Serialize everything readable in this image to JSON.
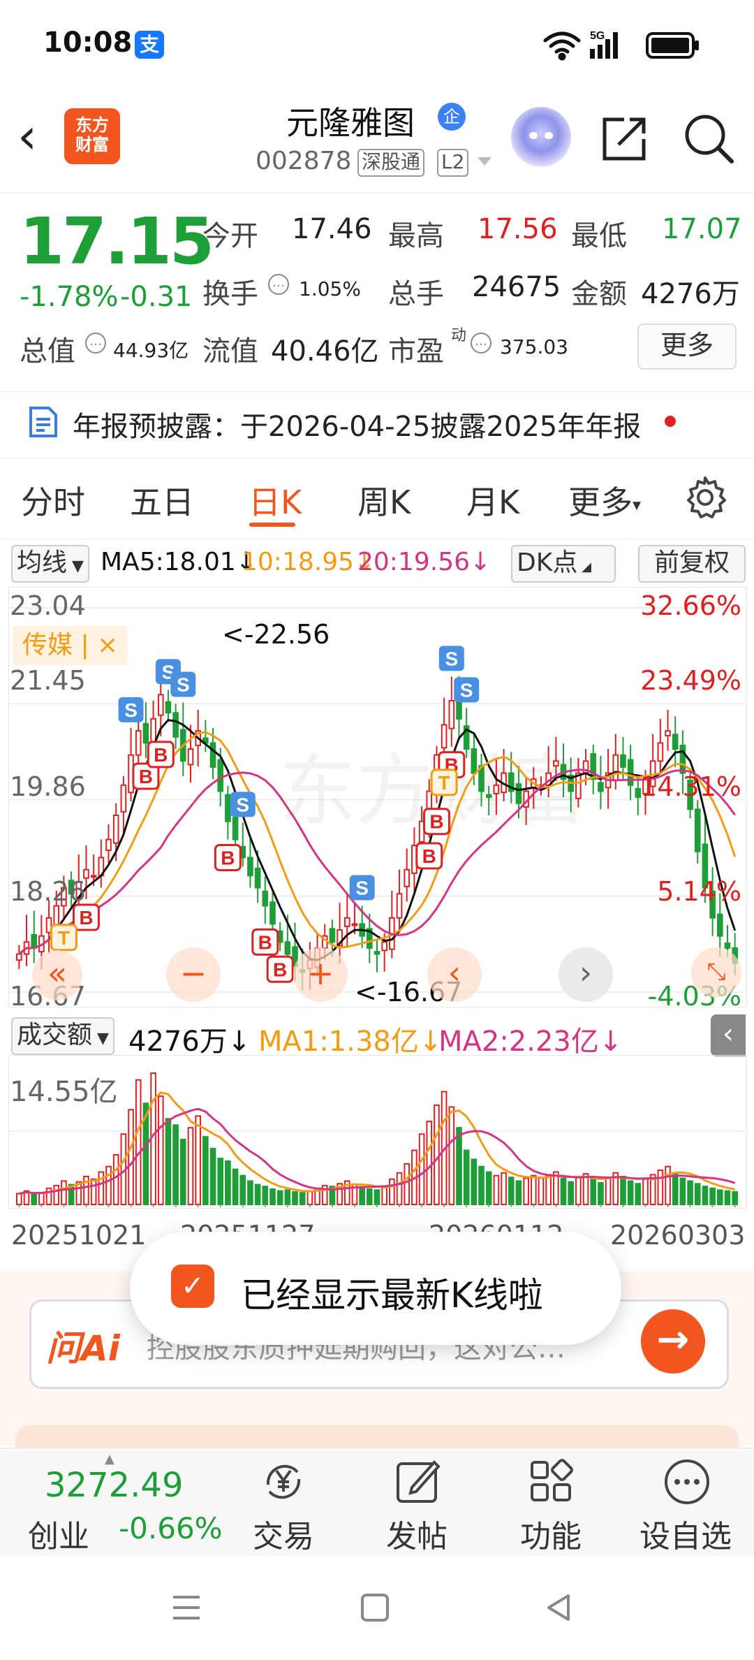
{
  "status_bar": {
    "time": "10:08",
    "alipay_glyph": "支",
    "network": "5G"
  },
  "header": {
    "back_glyph": "‹",
    "app_logo": [
      "东方",
      "财富"
    ],
    "stock_name": "元隆雅图",
    "enterprise_badge": "企",
    "stock_code": "002878",
    "tags": [
      "深股通",
      "L2"
    ]
  },
  "quote": {
    "price": "17.15",
    "change_pct": "-1.78%",
    "change_amt": "-0.31",
    "fields": [
      {
        "label": "今开",
        "value": "17.46"
      },
      {
        "label": "最高",
        "value": "17.56"
      },
      {
        "label": "最低",
        "value": "17.07"
      },
      {
        "label": "换手",
        "value": "1.05%"
      },
      {
        "label": "总手",
        "value": "24675"
      },
      {
        "label": "金额",
        "value": "4276万"
      },
      {
        "label": "总值",
        "value": "44.93亿"
      },
      {
        "label": "流值",
        "value": "40.46亿"
      },
      {
        "label": "市盈",
        "value": "375.03",
        "superscript": "动"
      }
    ],
    "more_label": "更多"
  },
  "notice": {
    "text": "年报预披露：于2026-04-25披露2025年年报"
  },
  "tabs": {
    "items": [
      "分时",
      "五日",
      "日K",
      "周K",
      "月K",
      "更多"
    ],
    "active": "日K",
    "more_arrow": "▾"
  },
  "ma_bar": {
    "selector": "均线",
    "ma5": "MA5:18.01",
    "ma10": "10:18.95",
    "ma20": "20:19.56",
    "dk_label": "DK点",
    "adjust_label": "前复权"
  },
  "kline": {
    "y_ticks": [
      "23.04",
      "21.45",
      "19.86",
      "18.26",
      "16.67"
    ],
    "right_pcts": [
      "32.66%",
      "23.49%",
      "14.31%",
      "5.14%",
      "-4.03%"
    ],
    "sector_tag": "传媒",
    "sector_close": "×",
    "high_label": "<-22.56",
    "low_label": "<-16.67",
    "signal_s": "S",
    "signal_b": "B",
    "signal_t": "T",
    "watermark": "东方财富",
    "controls": {
      "zoom_out": "−",
      "zoom_in": "+"
    }
  },
  "volume": {
    "selector": "成交额",
    "value": "4276万",
    "ma1": "MA1:1.38亿",
    "ma2": "MA2:2.23亿",
    "y_tick": "14.55亿",
    "dates": [
      "20251021",
      "20251127",
      "20260112",
      "20260303"
    ]
  },
  "toast": {
    "text": "已经显示最新K线啦"
  },
  "ai": {
    "logo": "问Ai",
    "placeholder": "控股股东质押延期购回，这对公…"
  },
  "bottom_bar": {
    "index_value": "3272.49",
    "index_name": "创业",
    "index_change": "-0.66%",
    "items": [
      {
        "label": "交易",
        "icon": "yen-cycle-icon"
      },
      {
        "label": "发帖",
        "icon": "edit-icon"
      },
      {
        "label": "功能",
        "icon": "grid-icon"
      },
      {
        "label": "设自选",
        "icon": "more-dots-icon"
      }
    ]
  },
  "colors": {
    "up": "#e02020",
    "down": "#1d9e37",
    "accent": "#f2551e",
    "ma5": "#111111",
    "ma10": "#f39c12",
    "ma20": "#d63384"
  },
  "chart_data": {
    "type": "candlestick",
    "title": "",
    "ylim": [
      16.67,
      23.04
    ],
    "yticks": [
      23.04,
      21.45,
      19.86,
      18.26,
      16.67
    ],
    "x_dates": [
      "20251021",
      "20251127",
      "20260112",
      "20260303"
    ],
    "annotations": [
      {
        "label": "<-22.56",
        "value": 22.56
      },
      {
        "label": "<-16.67",
        "value": 16.67
      }
    ],
    "closes": [
      17.3,
      17.5,
      17.4,
      17.6,
      17.9,
      18.1,
      18.4,
      18.3,
      18.5,
      18.7,
      18.6,
      18.9,
      19.2,
      19.6,
      20.1,
      20.6,
      21.0,
      20.8,
      21.2,
      21.6,
      21.3,
      20.9,
      20.5,
      20.7,
      21.0,
      20.8,
      20.4,
      20.0,
      19.5,
      19.2,
      18.9,
      18.6,
      18.4,
      18.1,
      17.8,
      17.5,
      17.3,
      17.1,
      17.0,
      17.2,
      17.4,
      17.6,
      17.5,
      17.7,
      17.9,
      17.8,
      17.6,
      17.4,
      17.3,
      17.5,
      17.9,
      18.3,
      18.7,
      19.1,
      19.5,
      20.0,
      20.6,
      21.1,
      21.5,
      21.2,
      20.7,
      20.3,
      20.0,
      19.9,
      20.1,
      20.3,
      20.0,
      19.8,
      20.0,
      20.2,
      20.1,
      20.3,
      20.5,
      20.2,
      20.0,
      20.3,
      20.5,
      20.2,
      20.0,
      20.3,
      20.6,
      20.4,
      20.1,
      19.9,
      20.2,
      20.5,
      20.8,
      21.0,
      20.7,
      20.3,
      19.7,
      19.0,
      18.4,
      17.9,
      17.6,
      17.4,
      17.15
    ],
    "volume_series": [
      {
        "name": "MA1",
        "value": "1.38亿"
      },
      {
        "name": "MA2",
        "value": "2.23亿"
      }
    ],
    "volume_ylim": [
      0,
      14.55
    ],
    "volumes": [
      1.2,
      1.5,
      1.1,
      1.3,
      1.8,
      2.1,
      2.6,
      2.2,
      2.5,
      3.1,
      2.8,
      3.6,
      4.2,
      5.5,
      7.8,
      10.5,
      13.8,
      11.2,
      14.55,
      12.0,
      9.5,
      8.8,
      7.2,
      8.5,
      9.8,
      7.5,
      6.2,
      5.1,
      4.8,
      3.9,
      3.2,
      2.6,
      2.2,
      2.0,
      1.7,
      1.5,
      1.6,
      1.4,
      1.3,
      1.5,
      1.8,
      2.1,
      2.0,
      2.3,
      2.6,
      2.2,
      1.9,
      1.7,
      1.6,
      2.0,
      2.8,
      3.5,
      4.5,
      6.0,
      7.8,
      9.2,
      11.0,
      12.5,
      10.8,
      8.5,
      6.0,
      5.0,
      4.2,
      3.6,
      3.2,
      3.5,
      3.0,
      2.6,
      2.9,
      3.2,
      3.0,
      3.3,
      3.6,
      2.9,
      2.5,
      3.0,
      3.4,
      2.8,
      2.4,
      2.9,
      3.5,
      3.1,
      2.6,
      2.3,
      2.8,
      3.3,
      3.8,
      4.2,
      3.5,
      2.9,
      2.6,
      2.3,
      2.0,
      1.8,
      1.6,
      1.5,
      1.4
    ]
  }
}
